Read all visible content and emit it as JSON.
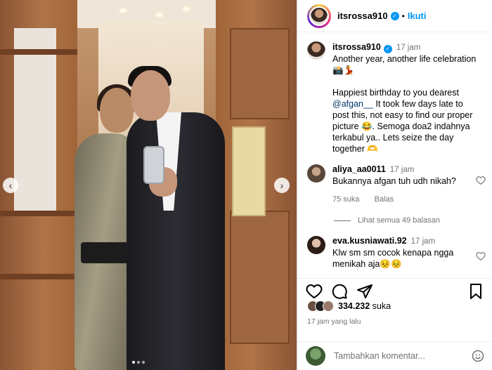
{
  "post": {
    "username": "itsrossa910",
    "follow_label": "Ikuti",
    "separator": "•",
    "time": "17 jam",
    "caption_line1": "Another year, another life celebration 📸💃",
    "caption_line2_pre": "Happiest birthday to you dearest ",
    "mention": "@afgan__",
    "caption_line2_post": " It took few days late to post this, not easy to find our proper picture 😂. Semoga doa2 indahnya terkabul ya.. Lets seize the day together 🫶"
  },
  "comments": [
    {
      "username": "aliya_aa0011",
      "time": "17 jam",
      "text": "Bukannya afgan tuh udh nikah?",
      "likes": "75 suka",
      "reply": "Balas",
      "view_replies": "Lihat semua 49 balasan"
    },
    {
      "username": "eva.kusniawati.92",
      "time": "17 jam",
      "text": "Klw sm sm cocok kenapa ngga menikah aja😣😣"
    }
  ],
  "stats": {
    "likes_count": "334.232",
    "likes_label": "suka",
    "posted_ago": "17 jam yang lalu"
  },
  "composer": {
    "placeholder": "Tambahkan komentar..."
  },
  "carousel": {
    "prev_icon": "chevron-left-icon",
    "next_icon": "chevron-right-icon"
  },
  "colors": {
    "accent": "#0095f6",
    "mention": "#00376b",
    "muted": "#737373"
  }
}
